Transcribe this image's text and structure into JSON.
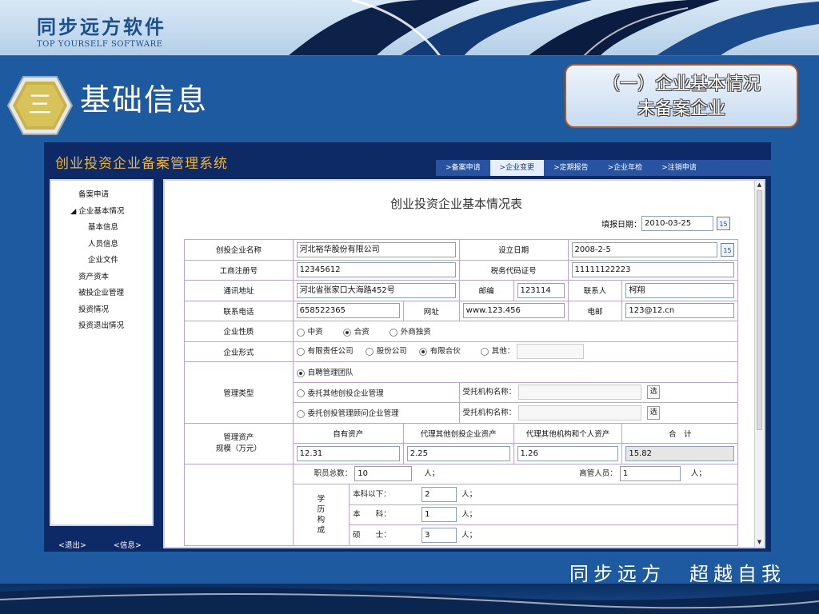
{
  "header": {
    "logo_cn": "同步远方软件",
    "logo_en": "TOP YOURSELF SOFTWARE"
  },
  "section": {
    "number": "三",
    "title": "基础信息"
  },
  "tag": {
    "line1": "（一）企业基本情况",
    "line2": "未备案企业"
  },
  "app": {
    "title": "创业投资企业备案管理系统",
    "nav": [
      {
        "label": ">备案申请",
        "active": false
      },
      {
        "label": ">企业变更",
        "active": true
      },
      {
        "label": ">定期报告",
        "active": false
      },
      {
        "label": ">企业年检",
        "active": false
      },
      {
        "label": ">注销申请",
        "active": false
      }
    ],
    "sidebar": [
      {
        "label": "备案申请",
        "indent": 1
      },
      {
        "label": "◢ 企业基本情况",
        "indent": 0
      },
      {
        "label": "基本信息",
        "indent": 2
      },
      {
        "label": "人员信息",
        "indent": 2
      },
      {
        "label": "企业文件",
        "indent": 2
      },
      {
        "label": "资产资本",
        "indent": 0
      },
      {
        "label": "被投企业管理",
        "indent": 0
      },
      {
        "label": "投资情况",
        "indent": 0
      },
      {
        "label": "投资退出情况",
        "indent": 0
      }
    ],
    "footer_left": "<退出>",
    "footer_right": "<信息>"
  },
  "form": {
    "title": "创业投资企业基本情况表",
    "fill_date_label": "填报日期：",
    "fill_date": "2010-03-25",
    "calendar_icon_label": "15",
    "rows": {
      "name_label": "创投企业名称",
      "name_value": "河北裕华股份有限公司",
      "setup_label": "设立日期",
      "setup_value": "2008-2-5",
      "reg_label": "工商注册号",
      "reg_value": "12345612",
      "tax_label": "税务代码证号",
      "tax_value": "11111122223",
      "addr_label": "通讯地址",
      "addr_value": "河北省张家口大海路452号",
      "zip_label": "邮编",
      "zip_value": "123114",
      "contact_label": "联系人",
      "contact_value": "柯翔",
      "phone_label": "联系电话",
      "phone_value": "658522365",
      "web_label": "网址",
      "web_value": "www.123.456",
      "email_label": "电邮",
      "email_value": "123@12.cn",
      "nature_label": "企业性质",
      "nature_options": [
        "中资",
        "合资",
        "外商独资"
      ],
      "nature_selected": 1,
      "form_label": "企业形式",
      "form_options": [
        "有限责任公司",
        "股份公司",
        "有限合伙",
        "其他："
      ],
      "form_selected": 2,
      "mgmt_label": "管理类型",
      "mgmt_opt1": "自聘管理团队",
      "mgmt_opt2": "委托其他创投企业管理",
      "mgmt_opt3": "委托创投管理顾问企业管理",
      "agency_label": "受托机构名称：",
      "select_btn": "选",
      "asset_label_1": "管理资产",
      "asset_label_2": "规模（万元）",
      "asset_h1": "自有资产",
      "asset_h2": "代理其他创投企业资产",
      "asset_h3": "代理其他机构和个人资产",
      "asset_h4": "合　计",
      "asset_v1": "12.31",
      "asset_v2": "2.25",
      "asset_v3": "1.26",
      "asset_v4": "15.82",
      "staff_label": "职员总数：",
      "staff_value": "10",
      "unit": "人；",
      "senior_label": "高管人员：",
      "senior_value": "1",
      "edu_label": "学历构成",
      "edu_rows": [
        {
          "label": "本科以下：",
          "value": "2"
        },
        {
          "label": "本　　科：",
          "value": "1"
        },
        {
          "label": "硕　　士：",
          "value": "3"
        }
      ]
    }
  },
  "slogan": "同步远方　超越自我",
  "colors": {
    "bg": "#1d5aa0",
    "app_bg": "#0e2a66",
    "app_title": "#f0b534",
    "table_border": "#b9a6e0",
    "tag_border": "#b5581f"
  }
}
